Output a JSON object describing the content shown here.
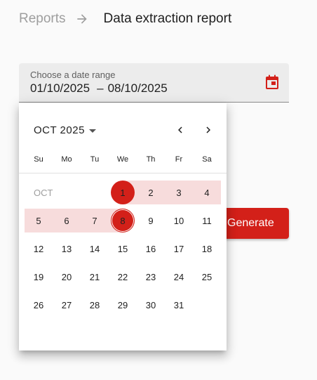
{
  "breadcrumb": {
    "parent": "Reports",
    "current": "Data extraction report"
  },
  "date_field": {
    "label": "Choose a date range",
    "start": "01/10/2025",
    "separator": "–",
    "end": "08/10/2025"
  },
  "generate_button": {
    "label": "Generate"
  },
  "calendar": {
    "period_label": "OCT 2025",
    "weekdays": [
      "Su",
      "Mo",
      "Tu",
      "We",
      "Th",
      "Fr",
      "Sa"
    ],
    "month_label": "OCT",
    "weeks": [
      [
        "",
        "",
        "",
        "1",
        "2",
        "3",
        "4"
      ],
      [
        "5",
        "6",
        "7",
        "8",
        "9",
        "10",
        "11"
      ],
      [
        "12",
        "13",
        "14",
        "15",
        "16",
        "17",
        "18"
      ],
      [
        "19",
        "20",
        "21",
        "22",
        "23",
        "24",
        "25"
      ],
      [
        "26",
        "27",
        "28",
        "29",
        "30",
        "31",
        ""
      ]
    ],
    "range_start": 1,
    "range_end": 8,
    "today": 8
  },
  "colors": {
    "accent": "#d32019",
    "range_fill": "#f7dcdc",
    "muted_text": "#9e9e9e"
  },
  "icons": {
    "breadcrumb_separator": "arrow-right-icon",
    "calendar_toggle": "calendar-icon",
    "prev_month": "chevron-left-icon",
    "next_month": "chevron-right-icon",
    "period_dropdown": "caret-down-icon"
  }
}
